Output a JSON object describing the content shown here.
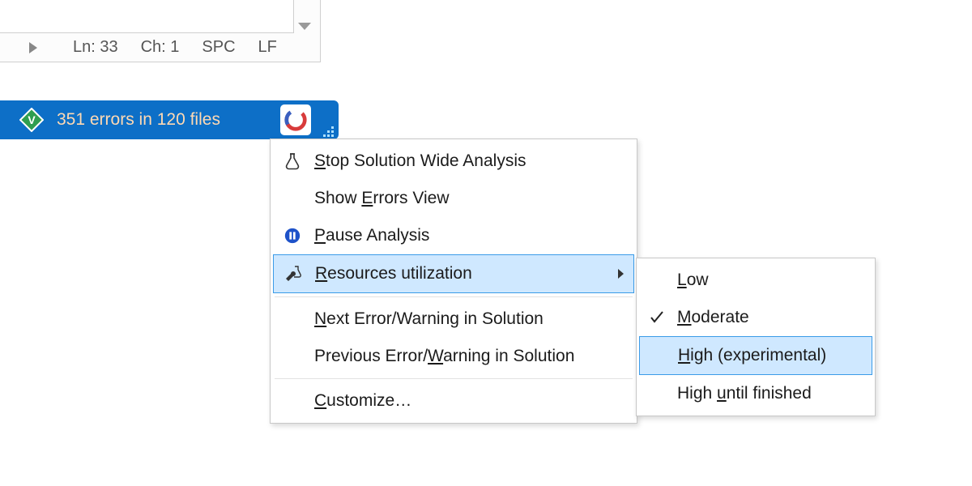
{
  "info_bar": {
    "line": "Ln: 33",
    "char": "Ch: 1",
    "indent": "SPC",
    "lineending": "LF"
  },
  "status_bar": {
    "errors_text": "351 errors in 120 files"
  },
  "context_menu": {
    "stop": "Stop Solution Wide Analysis",
    "show_errors": "Show Errors View",
    "pause": "Pause Analysis",
    "resources": "Resources utilization",
    "next": "Next Error/Warning in Solution",
    "previous": "Previous Error/Warning in Solution",
    "customize": "Customize…"
  },
  "submenu": {
    "low": "Low",
    "moderate": "Moderate",
    "high": "High (experimental)",
    "high_until": "High until finished"
  }
}
